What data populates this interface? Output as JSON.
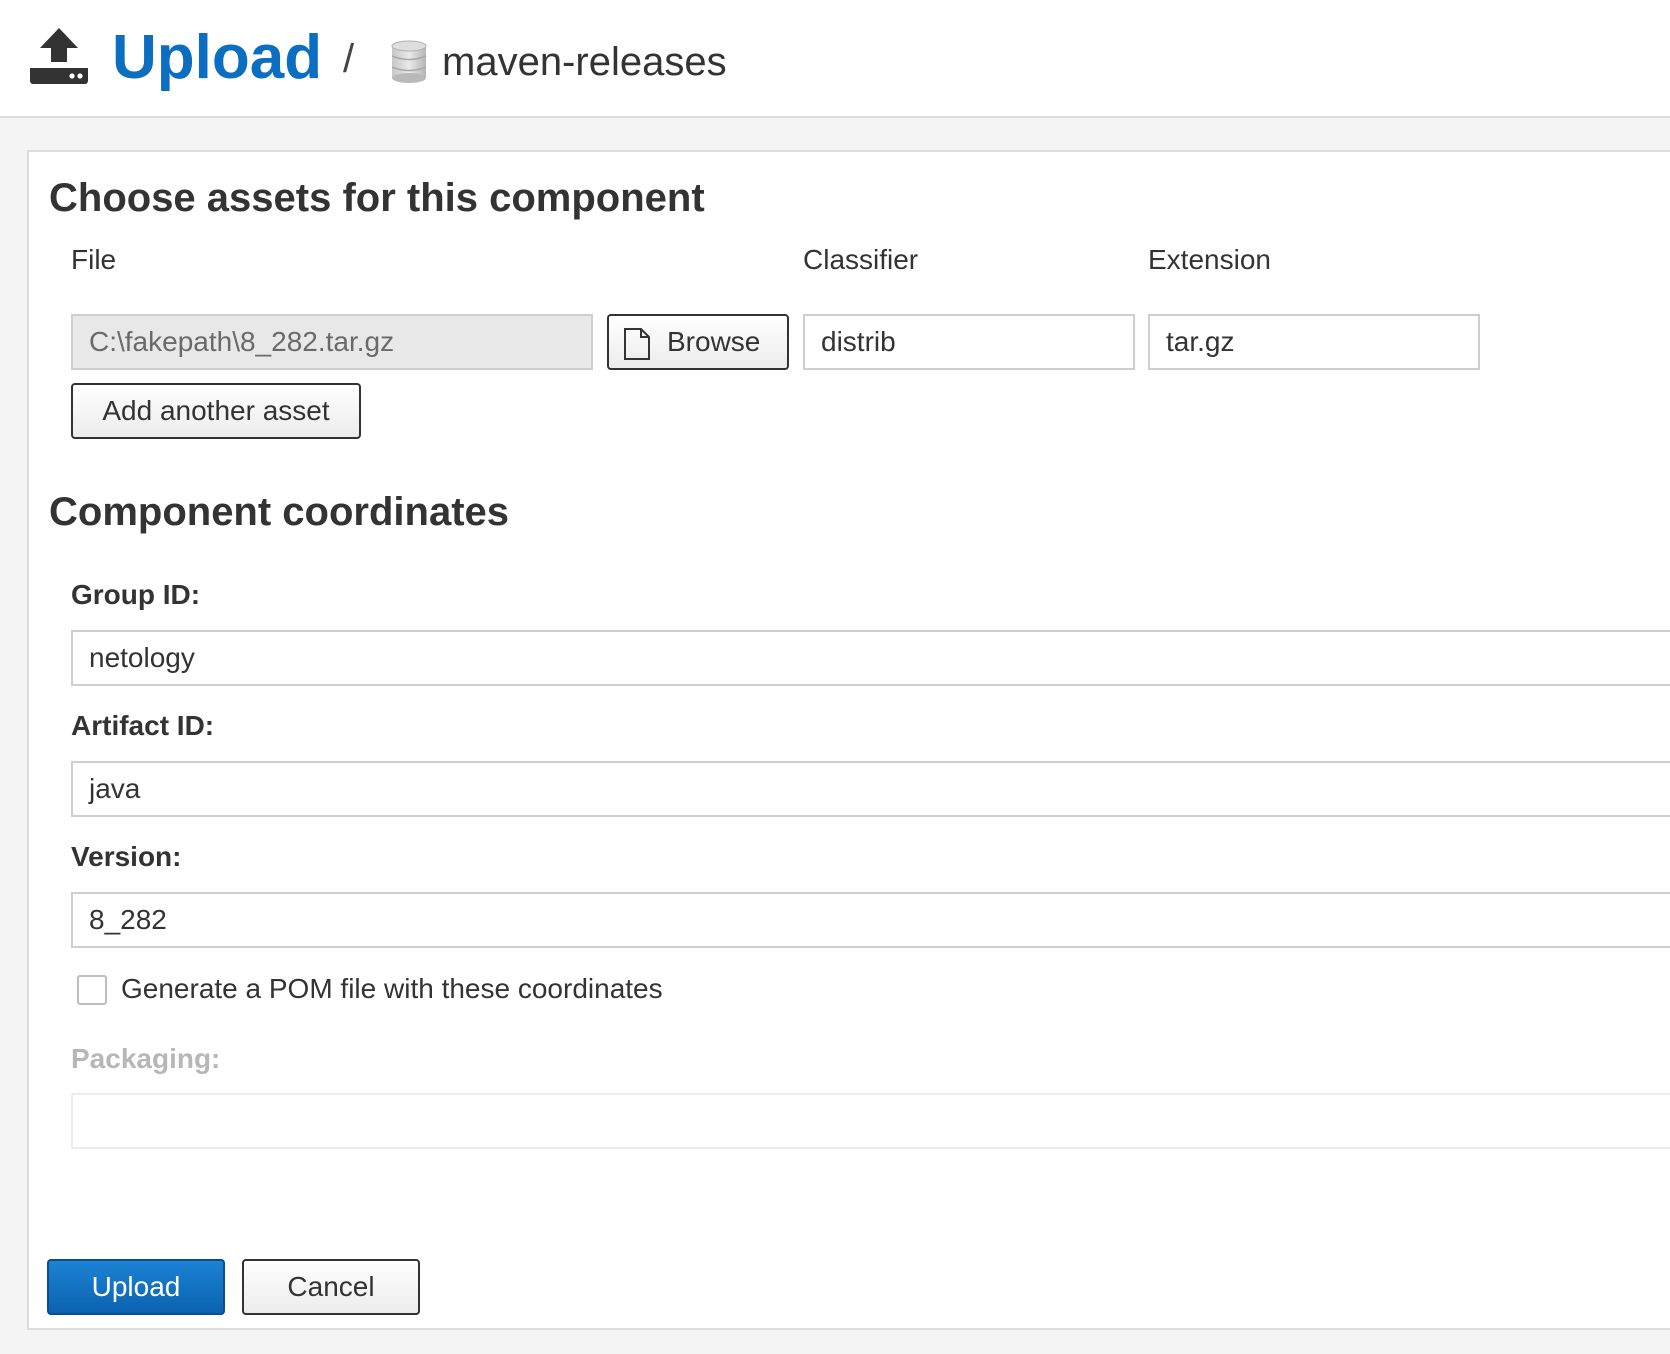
{
  "header": {
    "title": "Upload",
    "separator": "/",
    "repository": "maven-releases",
    "icons": {
      "upload": "upload-icon",
      "repository": "database-icon"
    },
    "accent_color": "#0b6ec0"
  },
  "assets": {
    "section_title": "Choose assets for this component",
    "columns": {
      "file": "File",
      "classifier": "Classifier",
      "extension": "Extension"
    },
    "rows": [
      {
        "file": "C:\\fakepath\\8_282.tar.gz",
        "browse_label": "Browse",
        "classifier": "distrib",
        "extension": "tar.gz"
      }
    ],
    "add_asset_label": "Add another asset"
  },
  "coordinates": {
    "section_title": "Component coordinates",
    "group_id": {
      "label": "Group ID:",
      "value": "netology"
    },
    "artifact_id": {
      "label": "Artifact ID:",
      "value": "java"
    },
    "version": {
      "label": "Version:",
      "value": "8_282"
    },
    "generate_pom": {
      "label": "Generate a POM file with these coordinates",
      "checked": false
    },
    "packaging": {
      "label": "Packaging:",
      "value": "",
      "disabled": true
    }
  },
  "actions": {
    "upload_label": "Upload",
    "cancel_label": "Cancel",
    "primary_color": "#0b63b0"
  }
}
